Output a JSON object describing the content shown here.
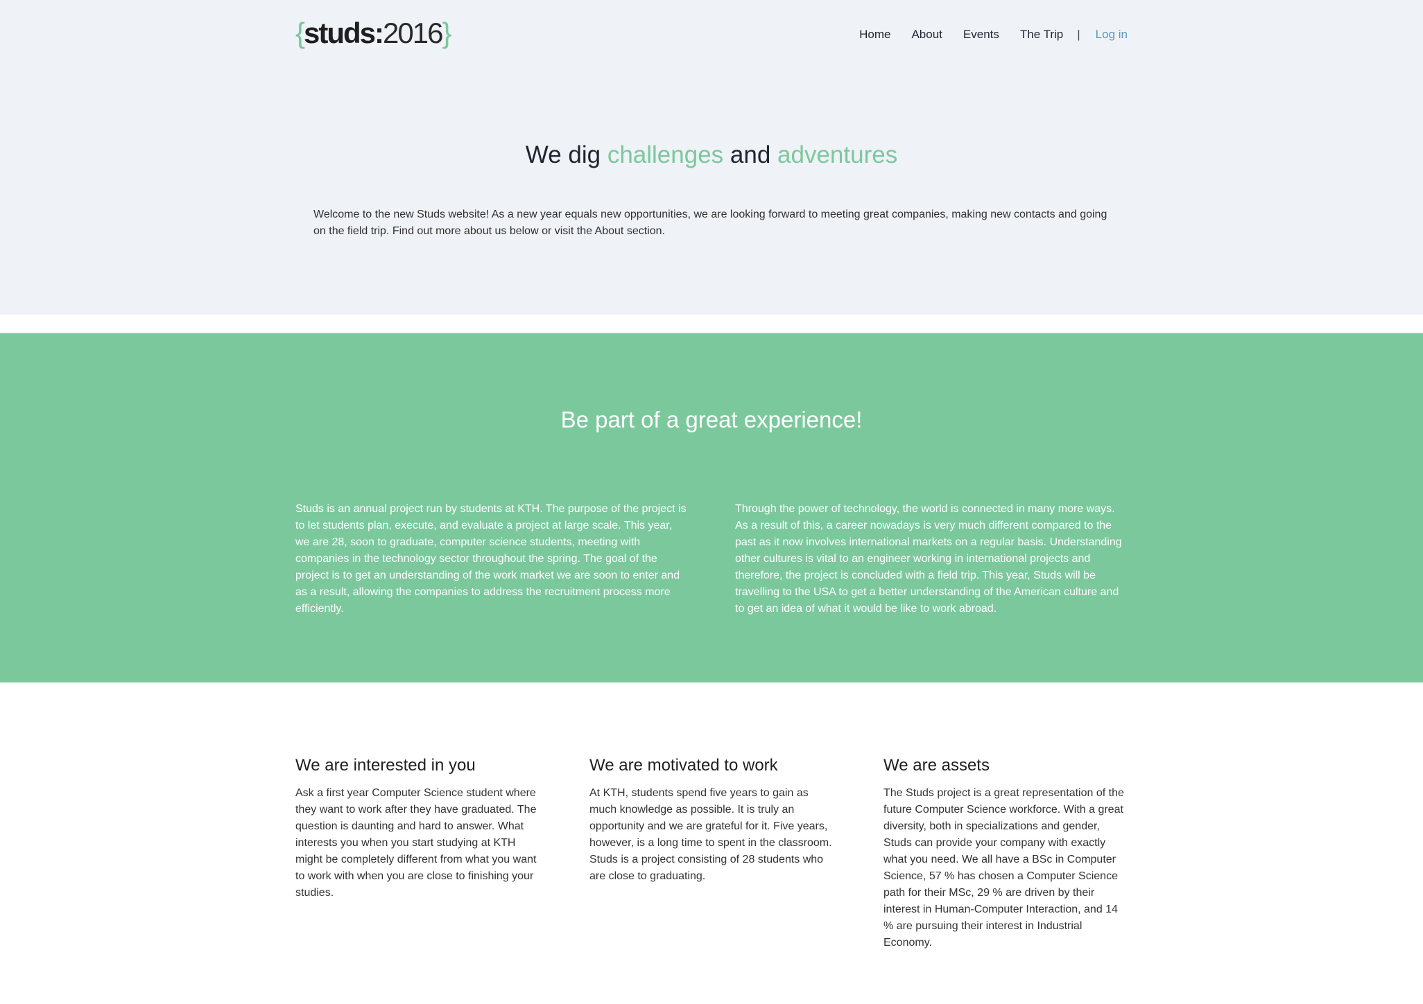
{
  "colors": {
    "accent": "#7cc89d",
    "hero_background": "#eff2f7",
    "link": "#5f95bd",
    "text": "#1f2530"
  },
  "logo": {
    "open_brace": "{",
    "word": "studs:",
    "year": "2016",
    "close_brace": "}"
  },
  "nav": {
    "items": [
      {
        "label": "Home"
      },
      {
        "label": "About"
      },
      {
        "label": "Events"
      },
      {
        "label": "The Trip"
      }
    ],
    "separator": "|",
    "login": "Log in"
  },
  "hero": {
    "title_part1": "We dig ",
    "title_accent1": "challenges",
    "title_part2": " and ",
    "title_accent2": "adventures",
    "text": "Welcome to the new Studs website! As a new year equals new opportunities, we are looking forward to meeting great companies, making new contacts and going on the field trip. Find out more about us below or visit the About section."
  },
  "band": {
    "title": "Be part of a great experience!",
    "left": "Studs is an annual project run by students at KTH. The purpose of the project is to let students plan, execute, and evaluate a project at large scale. This year, we are 28, soon to graduate, computer science students, meeting with companies in the technology sector throughout the spring. The goal of the project is to get an understanding of the work market we are soon to enter and as a result, allowing the companies to address the recruitment process more efficiently.",
    "right": "Through the power of technology, the world is connected in many more ways. As a result of this, a career nowadays is very much different compared to the past as it now involves international markets on a regular basis. Understanding other cultures is vital to an engineer working in international projects and therefore, the project is concluded with a field trip. This year, Studs will be travelling to the USA to get a better understanding of the American culture and to get an idea of what it would be like to work abroad."
  },
  "features": [
    {
      "title": "We are interested in you",
      "text": "Ask a first year Computer Science student where they want to work after they have graduated. The question is daunting and hard to answer. What interests you when you start studying at KTH might be completely different from what you want to work with when you are close to finishing your studies."
    },
    {
      "title": "We are motivated to work",
      "text": "At KTH, students spend five years to gain as much knowledge as possible. It is truly an opportunity and we are grateful for it. Five years, however, is a long time to spent in the classroom. Studs is a project consisting of 28 students who are close to graduating."
    },
    {
      "title": "We are assets",
      "text": "The Studs project is a great representation of the future Computer Science workforce. With a great diversity, both in specializations and gender, Studs can provide your company with exactly what you need. We all have a BSc in Computer Science, 57 % has chosen a Computer Science path for their MSc, 29 % are driven by their interest in Human-Computer Interaction, and 14 % are pursuing their interest in Industrial Economy."
    }
  ]
}
